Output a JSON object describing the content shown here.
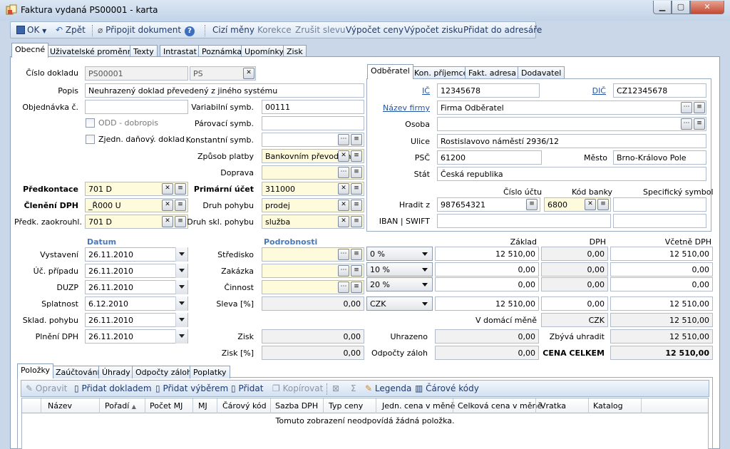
{
  "window": {
    "title": "Faktura vydaná PS00001 - karta",
    "buttons": {
      "minimize": "▁",
      "maximize": "▢",
      "close": "✕"
    }
  },
  "toolbar": {
    "ok": "OK",
    "back": "Zpět",
    "attach": "Připojit dokument",
    "foreign_currency": "Cizí měny",
    "correction": "Korekce",
    "cancel_discount": "Zrušit slevu",
    "calc_prices": "Výpočet ceny",
    "calc_profit": "Výpočet zisku",
    "add_to_addressbook": "Přidat do adresáře"
  },
  "main_tabs": [
    "Obecné",
    "Uživatelské proměnné",
    "Texty",
    "Intrastat",
    "Poznámka",
    "Upomínky",
    "Zisk"
  ],
  "general": {
    "doc_number_label": "Číslo dokladu",
    "doc_number": "PS00001",
    "series": "PS",
    "description_label": "Popis",
    "description": "Neuhrazený doklad převedený z jiného systému",
    "order_label": "Objednávka č.",
    "order": "",
    "odd_label": "ODD - dobropis",
    "simplified_label": "Zjedn. daňový. doklad",
    "var_symbol_label": "Variabilní symb.",
    "var_symbol": "00111",
    "pair_symbol_label": "Párovací symb.",
    "pair_symbol": "",
    "const_symbol_label": "Konstantní symb.",
    "const_symbol": "",
    "payment_label": "Způsob platby",
    "payment": "Bankovním převodem",
    "transport_label": "Doprava",
    "transport": "",
    "precontrol_label": "Předkontace",
    "precontrol": "701 D",
    "vat_class_label": "Členění DPH",
    "vat_class": "_Ř000 U",
    "rounding_label": "Předk. zaokrouhl.",
    "rounding": "701 D",
    "primary_account_label": "Primární účet",
    "primary_account": "311000",
    "movement_label": "Druh pohybu",
    "movement": "prodej",
    "stock_movement_label": "Druh skl. pohybu",
    "stock_movement": "služba"
  },
  "partner_tabs": [
    "Odběratel",
    "Kon. příjemce",
    "Fakt. adresa",
    "Dodavatel"
  ],
  "partner": {
    "ic_label": "IČ",
    "ic": "12345678",
    "dic_label": "DIČ",
    "dic": "CZ12345678",
    "company_label": "Název firmy",
    "company": "Firma Odběratel",
    "person_label": "Osoba",
    "person": "",
    "street_label": "Ulice",
    "street": "Rostislavovo náměstí 2936/12",
    "zip_label": "PSČ",
    "zip": "61200",
    "city_label": "Město",
    "city": "Brno-Královo Pole",
    "country_label": "Stát",
    "country": "Česká republika",
    "account_head": "Číslo účtu",
    "bank_head": "Kód banky",
    "specific_head": "Specifický symbol",
    "pay_from_label": "Hradit z",
    "account": "987654321",
    "bank_code": "6800",
    "specific": "",
    "iban_label": "IBAN | SWIFT",
    "iban": "",
    "swift": ""
  },
  "dates": {
    "head": "Datum",
    "issued_label": "Vystavení",
    "issued": "26.11.2010",
    "accounting_label": "Úč. případu",
    "accounting": "26.11.2010",
    "duzp_label": "DUZP",
    "duzp": "26.11.2010",
    "due_label": "Splatnost",
    "due": "6.12.2010",
    "stock_label": "Sklad. pohybu",
    "stock": "26.11.2010",
    "vat_fulfil_label": "Plnění DPH",
    "vat_fulfil": "26.11.2010"
  },
  "details": {
    "head": "Podrobnosti",
    "center_label": "Středisko",
    "center": "",
    "job_label": "Zakázka",
    "job": "",
    "activity_label": "Činnost",
    "activity": "",
    "discount_label": "Sleva [%]",
    "discount": "0,00",
    "profit_label": "Zisk",
    "profit": "0,00",
    "profit_pct_label": "Zisk [%]",
    "profit_pct": "0,00"
  },
  "totals": {
    "base_head": "Základ",
    "vat_head": "DPH",
    "incl_head": "Včetně DPH",
    "rows": [
      {
        "rate": "0 %",
        "base": "12 510,00",
        "vat": "0,00",
        "incl": "12 510,00"
      },
      {
        "rate": "10 %",
        "base": "0,00",
        "vat": "0,00",
        "incl": "0,00"
      },
      {
        "rate": "20 %",
        "base": "0,00",
        "vat": "0,00",
        "incl": "0,00"
      }
    ],
    "currency": "CZK",
    "sum_base": "12 510,00",
    "sum_vat": "0,00",
    "sum_incl": "12 510,00",
    "domestic_label": "V domácí měně",
    "domestic_currency": "CZK",
    "domestic_value": "12 510,00",
    "paid_label": "Uhrazeno",
    "paid": "0,00",
    "remaining_label": "Zbývá uhradit",
    "remaining": "12 510,00",
    "advance_label": "Odpočty záloh",
    "advance": "0,00",
    "total_label": "CENA CELKEM",
    "total": "12 510,00"
  },
  "bottom_tabs": [
    "Položky",
    "Zaúčtování",
    "Úhrady",
    "Odpočty záloh",
    "Poplatky"
  ],
  "grid_toolbar": {
    "edit": "Opravit",
    "add_doc": "Přidat dokladem",
    "add_select": "Přidat výběrem",
    "add": "Přidat",
    "copy": "Kopírovat",
    "sum": "Σ",
    "legend": "Legenda",
    "barcodes": "Čárové kódy"
  },
  "grid": {
    "columns": [
      "Název",
      "Pořadí",
      "Počet MJ",
      "MJ",
      "Čárový kód",
      "Sazba DPH",
      "Typ ceny",
      "Jedn. cena v měně",
      "Celková cena v měně",
      "Vratka",
      "Katalog"
    ],
    "empty_message": "Tomuto zobrazení neodpovídá žádná položka."
  }
}
